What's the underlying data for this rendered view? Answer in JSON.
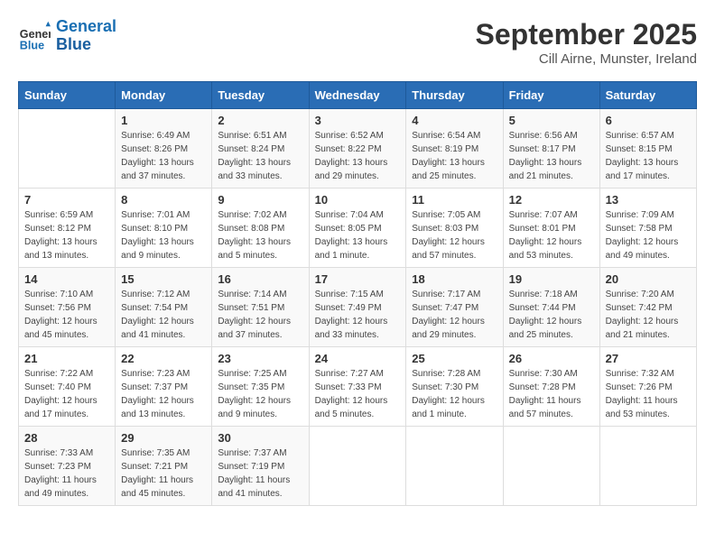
{
  "logo": {
    "line1": "General",
    "line2": "Blue"
  },
  "title": "September 2025",
  "location": "Cill Airne, Munster, Ireland",
  "days_of_week": [
    "Sunday",
    "Monday",
    "Tuesday",
    "Wednesday",
    "Thursday",
    "Friday",
    "Saturday"
  ],
  "weeks": [
    [
      null,
      {
        "day": "1",
        "sunrise": "6:49 AM",
        "sunset": "8:26 PM",
        "daylight": "13 hours and 37 minutes."
      },
      {
        "day": "2",
        "sunrise": "6:51 AM",
        "sunset": "8:24 PM",
        "daylight": "13 hours and 33 minutes."
      },
      {
        "day": "3",
        "sunrise": "6:52 AM",
        "sunset": "8:22 PM",
        "daylight": "13 hours and 29 minutes."
      },
      {
        "day": "4",
        "sunrise": "6:54 AM",
        "sunset": "8:19 PM",
        "daylight": "13 hours and 25 minutes."
      },
      {
        "day": "5",
        "sunrise": "6:56 AM",
        "sunset": "8:17 PM",
        "daylight": "13 hours and 21 minutes."
      },
      {
        "day": "6",
        "sunrise": "6:57 AM",
        "sunset": "8:15 PM",
        "daylight": "13 hours and 17 minutes."
      }
    ],
    [
      {
        "day": "7",
        "sunrise": "6:59 AM",
        "sunset": "8:12 PM",
        "daylight": "13 hours and 13 minutes."
      },
      {
        "day": "8",
        "sunrise": "7:01 AM",
        "sunset": "8:10 PM",
        "daylight": "13 hours and 9 minutes."
      },
      {
        "day": "9",
        "sunrise": "7:02 AM",
        "sunset": "8:08 PM",
        "daylight": "13 hours and 5 minutes."
      },
      {
        "day": "10",
        "sunrise": "7:04 AM",
        "sunset": "8:05 PM",
        "daylight": "13 hours and 1 minute."
      },
      {
        "day": "11",
        "sunrise": "7:05 AM",
        "sunset": "8:03 PM",
        "daylight": "12 hours and 57 minutes."
      },
      {
        "day": "12",
        "sunrise": "7:07 AM",
        "sunset": "8:01 PM",
        "daylight": "12 hours and 53 minutes."
      },
      {
        "day": "13",
        "sunrise": "7:09 AM",
        "sunset": "7:58 PM",
        "daylight": "12 hours and 49 minutes."
      }
    ],
    [
      {
        "day": "14",
        "sunrise": "7:10 AM",
        "sunset": "7:56 PM",
        "daylight": "12 hours and 45 minutes."
      },
      {
        "day": "15",
        "sunrise": "7:12 AM",
        "sunset": "7:54 PM",
        "daylight": "12 hours and 41 minutes."
      },
      {
        "day": "16",
        "sunrise": "7:14 AM",
        "sunset": "7:51 PM",
        "daylight": "12 hours and 37 minutes."
      },
      {
        "day": "17",
        "sunrise": "7:15 AM",
        "sunset": "7:49 PM",
        "daylight": "12 hours and 33 minutes."
      },
      {
        "day": "18",
        "sunrise": "7:17 AM",
        "sunset": "7:47 PM",
        "daylight": "12 hours and 29 minutes."
      },
      {
        "day": "19",
        "sunrise": "7:18 AM",
        "sunset": "7:44 PM",
        "daylight": "12 hours and 25 minutes."
      },
      {
        "day": "20",
        "sunrise": "7:20 AM",
        "sunset": "7:42 PM",
        "daylight": "12 hours and 21 minutes."
      }
    ],
    [
      {
        "day": "21",
        "sunrise": "7:22 AM",
        "sunset": "7:40 PM",
        "daylight": "12 hours and 17 minutes."
      },
      {
        "day": "22",
        "sunrise": "7:23 AM",
        "sunset": "7:37 PM",
        "daylight": "12 hours and 13 minutes."
      },
      {
        "day": "23",
        "sunrise": "7:25 AM",
        "sunset": "7:35 PM",
        "daylight": "12 hours and 9 minutes."
      },
      {
        "day": "24",
        "sunrise": "7:27 AM",
        "sunset": "7:33 PM",
        "daylight": "12 hours and 5 minutes."
      },
      {
        "day": "25",
        "sunrise": "7:28 AM",
        "sunset": "7:30 PM",
        "daylight": "12 hours and 1 minute."
      },
      {
        "day": "26",
        "sunrise": "7:30 AM",
        "sunset": "7:28 PM",
        "daylight": "11 hours and 57 minutes."
      },
      {
        "day": "27",
        "sunrise": "7:32 AM",
        "sunset": "7:26 PM",
        "daylight": "11 hours and 53 minutes."
      }
    ],
    [
      {
        "day": "28",
        "sunrise": "7:33 AM",
        "sunset": "7:23 PM",
        "daylight": "11 hours and 49 minutes."
      },
      {
        "day": "29",
        "sunrise": "7:35 AM",
        "sunset": "7:21 PM",
        "daylight": "11 hours and 45 minutes."
      },
      {
        "day": "30",
        "sunrise": "7:37 AM",
        "sunset": "7:19 PM",
        "daylight": "11 hours and 41 minutes."
      },
      null,
      null,
      null,
      null
    ]
  ]
}
